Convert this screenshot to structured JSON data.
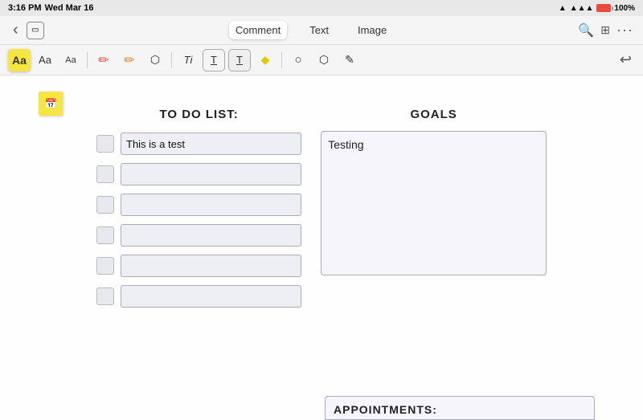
{
  "status_bar": {
    "time": "3:16 PM",
    "date": "Wed Mar 16",
    "wifi": "WiFi",
    "battery": "100%"
  },
  "nav": {
    "back_label": "‹",
    "tabs": [
      {
        "id": "comment",
        "label": "Comment",
        "active": true
      },
      {
        "id": "text",
        "label": "Text",
        "active": false
      },
      {
        "id": "image",
        "label": "Image",
        "active": false
      }
    ],
    "icons": {
      "search": "🔍",
      "grid": "⊞",
      "more": "···"
    }
  },
  "toolbar": {
    "tools": [
      {
        "id": "font-bold",
        "label": "Aa",
        "active": true,
        "style": "yellow"
      },
      {
        "id": "font-medium",
        "label": "Aa",
        "active": false,
        "style": ""
      },
      {
        "id": "font-small",
        "label": "Aa",
        "active": false,
        "style": ""
      },
      {
        "id": "pen-red",
        "label": "✏",
        "active": false,
        "style": "red"
      },
      {
        "id": "pen-orange",
        "label": "✏",
        "active": false,
        "style": "orange"
      },
      {
        "id": "eraser",
        "label": "◻",
        "active": false,
        "style": ""
      },
      {
        "id": "ti",
        "label": "Ti",
        "active": false,
        "style": ""
      },
      {
        "id": "text-box1",
        "label": "T̲",
        "active": false,
        "style": ""
      },
      {
        "id": "text-box2",
        "label": "T̲",
        "active": false,
        "style": ""
      },
      {
        "id": "highlight",
        "label": "◆",
        "active": false,
        "style": "yellow"
      },
      {
        "id": "shape1",
        "label": "○",
        "active": false,
        "style": ""
      },
      {
        "id": "shape2",
        "label": "⬡",
        "active": false,
        "style": ""
      },
      {
        "id": "shape3",
        "label": "✎",
        "active": false,
        "style": ""
      }
    ],
    "undo": "↩"
  },
  "page": {
    "todo_title": "TO DO LIST:",
    "todo_items": [
      {
        "id": 1,
        "text": "This is a test",
        "checked": false
      },
      {
        "id": 2,
        "text": "",
        "checked": false
      },
      {
        "id": 3,
        "text": "",
        "checked": false
      },
      {
        "id": 4,
        "text": "",
        "checked": false
      },
      {
        "id": 5,
        "text": "",
        "checked": false
      },
      {
        "id": 6,
        "text": "",
        "checked": false
      }
    ],
    "goals_title": "GOALS",
    "goals_text": "Testing",
    "appointments_title": "APPOINTMENTS:"
  }
}
